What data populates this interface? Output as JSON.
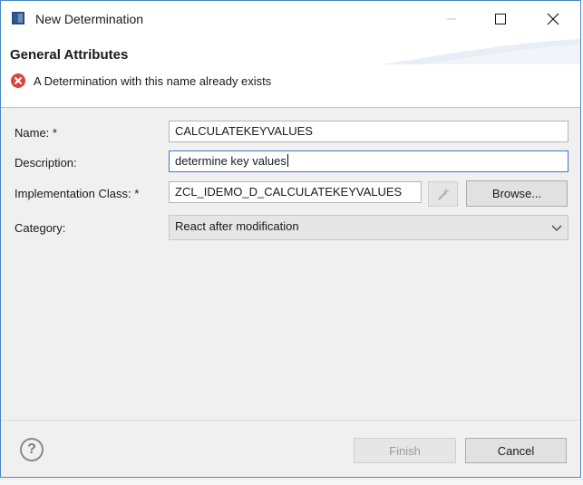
{
  "window": {
    "title": "New Determination"
  },
  "header": {
    "section_title": "General Attributes",
    "error_message": "A Determination with this name already exists"
  },
  "form": {
    "name_label": "Name: *",
    "name_value": "CALCULATEKEYVALUES",
    "description_label": "Description:",
    "description_value": "determine key values",
    "impl_label": "Implementation Class: *",
    "impl_value": "ZCL_IDEMO_D_CALCULATEKEYVALUES",
    "browse_label": "Browse...",
    "category_label": "Category:",
    "category_value": "React after modification"
  },
  "footer": {
    "help_symbol": "?",
    "finish_label": "Finish",
    "cancel_label": "Cancel"
  },
  "icons": {
    "app": "app-window-icon",
    "error": "error-icon",
    "wand": "magic-wand-icon",
    "chevron": "chevron-down-icon",
    "help": "help-icon"
  },
  "colors": {
    "error_red": "#d9453a",
    "focus_blue": "#2f7cd1",
    "window_border": "#4a86c8"
  }
}
